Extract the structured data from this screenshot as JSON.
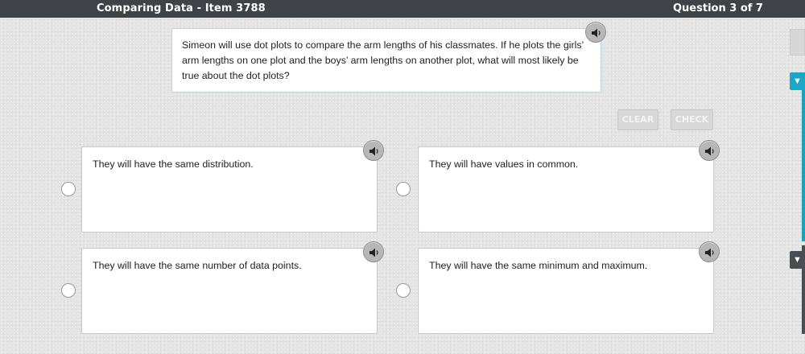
{
  "header": {
    "title": "Comparing Data - Item 3788",
    "question_counter": "Question 3 of 7"
  },
  "question": {
    "text": "Simeon will use dot plots to compare the arm lengths of his classmates. If he plots the girls’ arm lengths on one plot and the boys’ arm lengths on another plot, what will most likely be true about the dot plots?",
    "audio_icon": "speaker-icon"
  },
  "actions": {
    "clear_label": "CLEAR",
    "check_label": "CHECK"
  },
  "answers": [
    {
      "text": "They will have the same distribution.",
      "selected": false
    },
    {
      "text": "They will have values in common.",
      "selected": false
    },
    {
      "text": "They will have the same number of data points.",
      "selected": false
    },
    {
      "text": "They will have the same minimum and maximum.",
      "selected": false
    }
  ],
  "side_panel": {
    "expand_icon": "triangle-down-icon",
    "accent_color": "#19a8c7",
    "dark_color": "#4a4d52"
  }
}
